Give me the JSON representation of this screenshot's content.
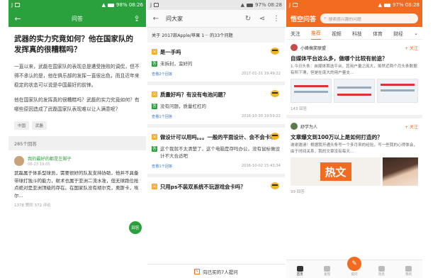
{
  "phone1": {
    "status": {
      "left": "J",
      "right": "98% 08:26"
    },
    "appbar": {
      "title": "问答"
    },
    "question": "武器的实力究竟如何？他在国家队的发挥真的很糟糕吗？",
    "para1": "一直以来，武磊在国家队的表现总是遭受挫败的调侃，但不得不承认的是，他在俱乐部的发挥一直很出色，而且近年来稳定的状态可以说是中国最好的前锋。",
    "para2": "他在国家队的发挥真的很糟糕吗？武磊的实力究竟如何？有哪些原因造成了武磊国家队表现难以让人满意呢？",
    "tags": [
      "中国",
      "武磊"
    ],
    "answers_count": "285个回答",
    "answer": {
      "user": "我的最好的都是左脚子",
      "time": "08-23 19:05",
      "body": "武磊属于体系型球员，需要很好的队友支持协助，他并不具备带球打独斗的能力，射术也属于亚洲二流水准，但无球跑位抢点绝对是亚洲顶级的存在。在国家队没有胡尔克，奥斯卡，埃尔...",
      "stats": "1378 赞同   372 评论"
    },
    "fab": "回答"
  },
  "phone2": {
    "status": {
      "left": "J",
      "right": "97% 08:28"
    },
    "appbar": {
      "title": "问大家"
    },
    "about": "关于 2017款Apple/苹果 1··· 的33个问题",
    "questions": [
      {
        "q": "是一手吗",
        "a": "未拆封，蛮好的",
        "link": "查看2个回答",
        "date": "2017-01-31 19:49:22"
      },
      {
        "q": "质量好吗？有没有电池问题？",
        "a": "没有问题，质量杠杠的",
        "link": "查看1个回答",
        "date": "2016-10-30 19:59:22"
      },
      {
        "q": "做设计可以用吗。。。一般的平面设计、会不会卡啊",
        "a": "这个我就不太清楚了，这个电脑是存吗办公，没有鼠标做设计不大合适吧",
        "link": "查看1个回答",
        "date": "2016-10-02 15:43:34"
      },
      {
        "q": "只用ps不装双系统不玩游戏会卡吗？",
        "a": "",
        "link": "",
        "date": ""
      }
    ],
    "footer": "向已买的7人提问"
  },
  "phone3": {
    "status": {
      "left": "J",
      "right": "97% 08:28"
    },
    "logo": "悟空问答",
    "search_placeholder": "搜索感兴趣的问题",
    "tabs": [
      "关注",
      "推荐",
      "视频",
      "科技",
      "体育",
      "财经",
      "⌄"
    ],
    "posts": [
      {
        "user": "小峰搞笑联盟",
        "follow": "+ 关注",
        "title": "自媒体平台这么多，做哪个比较有前途？",
        "body": "1.今日头条：自媒体首选平台，其用户量之庞大，虽然近两个月头条数据有所下滑，但是在庞大的用户量支...",
        "count": "143 回答"
      },
      {
        "user": "舒学为人",
        "follow": "+ 关注",
        "title": "文章爆文到100万以上是如何打造的？",
        "body": "谢谢邀请！根据我开通头条号一个多月来的经验，写一些我的心得体会，由于时间关系，我的文章没有每天...",
        "hot_text": "热文",
        "count": "99 回答"
      }
    ],
    "nav": [
      "首页",
      "发现",
      "提问",
      "消息",
      "我的"
    ]
  },
  "colors": {
    "green": "#2aa13d",
    "orange": "#f36b21"
  }
}
